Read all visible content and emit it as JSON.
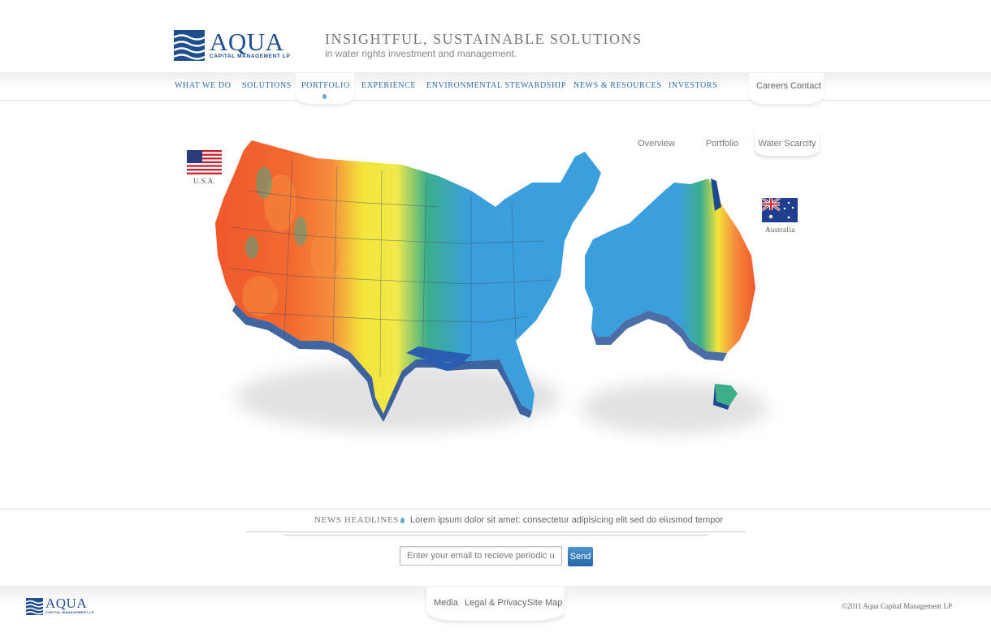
{
  "brand": {
    "name": "AQUA",
    "subtitle": "CAPITAL MANAGEMENT LP"
  },
  "tagline": {
    "title": "INSIGHTFUL, SUSTAINABLE SOLUTIONS",
    "subtitle": "in water rights investment and management."
  },
  "nav": {
    "items": [
      {
        "label": "WHAT WE DO"
      },
      {
        "label": "SOLUTIONS"
      },
      {
        "label": "PORTFOLIO",
        "active": true
      },
      {
        "label": "EXPERIENCE"
      },
      {
        "label": "ENVIRONMENTAL STEWARDSHIP"
      },
      {
        "label": "NEWS & RESOURCES"
      },
      {
        "label": "INVESTORS"
      }
    ],
    "utility": [
      {
        "label": "Careers"
      },
      {
        "label": "Contact"
      }
    ]
  },
  "map": {
    "tabs": [
      {
        "label": "Overview"
      },
      {
        "label": "Portfolio"
      },
      {
        "label": "Water Scarcity",
        "active": true
      }
    ],
    "usa_label": "U.S.A.",
    "australia_label": "Australia",
    "colors": {
      "arid": "#f0582c",
      "dry": "#f58c3c",
      "moderate": "#f4e43a",
      "humid": "#3cae8c",
      "wet": "#3a9fdc",
      "very_wet": "#2a5cb0"
    }
  },
  "news": {
    "label": "NEWS HEADLINES",
    "headline": "Lorem ipsum dolor sit amet: consectetur adipisicing elit sed do eiusmod tempor",
    "email_placeholder": "Enter your email to recieve periodic updates.",
    "send_label": "Send"
  },
  "footer": {
    "links": [
      {
        "label": "Media"
      },
      {
        "label": "Legal & Privacy"
      },
      {
        "label": "Site Map"
      }
    ],
    "copyright": "©2011 Aqua Capital Management LP"
  }
}
